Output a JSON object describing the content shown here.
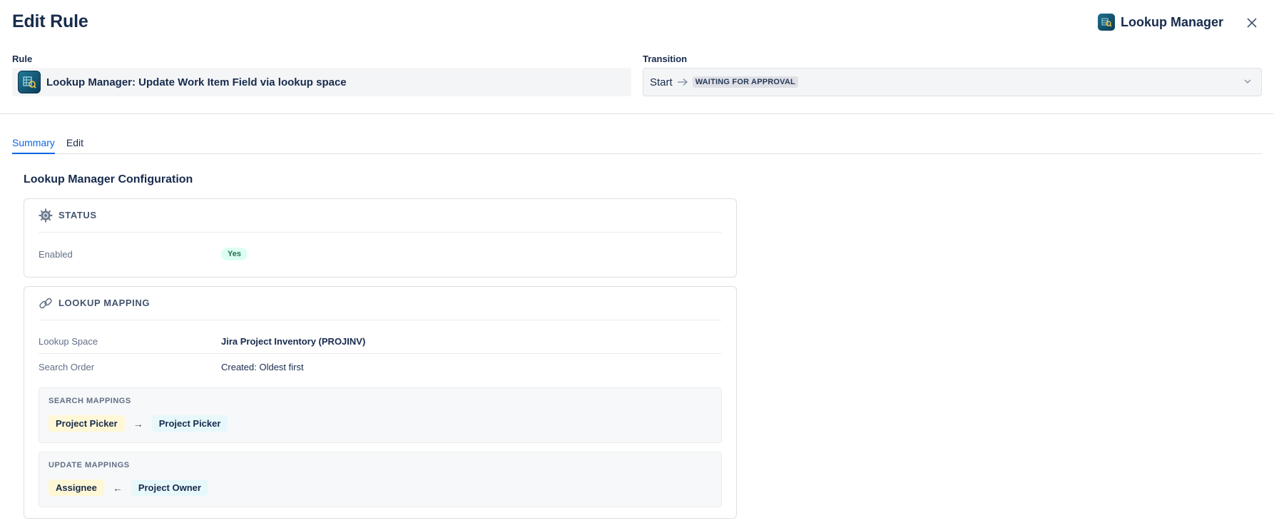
{
  "header": {
    "title": "Edit Rule",
    "app_name": "Lookup Manager"
  },
  "fields": {
    "rule_label": "Rule",
    "rule_value": "Lookup Manager: Update Work Item Field via lookup space",
    "transition_label": "Transition",
    "transition_start": "Start",
    "transition_arrow": "→",
    "transition_status": "WAITING FOR APPROVAL"
  },
  "tabs": [
    {
      "label": "Summary",
      "active": true
    },
    {
      "label": "Edit",
      "active": false
    }
  ],
  "summary": {
    "title": "Lookup Manager Configuration",
    "status_card": {
      "title": "STATUS",
      "icon": "gear-icon",
      "enabled_label": "Enabled",
      "enabled_value": "Yes"
    },
    "mapping_card": {
      "title": "LOOKUP MAPPING",
      "icon": "link-icon",
      "lookup_space_label": "Lookup Space",
      "lookup_space_value": "Jira Project Inventory (PROJINV)",
      "search_order_label": "Search Order",
      "search_order_value": "Created: Oldest first",
      "search_mappings": {
        "title": "SEARCH MAPPINGS",
        "source": "Project Picker",
        "arrow": "→",
        "target": "Project Picker"
      },
      "update_mappings": {
        "title": "UPDATE MAPPINGS",
        "target": "Assignee",
        "arrow": "←",
        "source": "Project Owner"
      }
    }
  },
  "colors": {
    "accent": "#0c66e4",
    "success_bg": "#dcfff1",
    "success_text": "#216e4e"
  }
}
